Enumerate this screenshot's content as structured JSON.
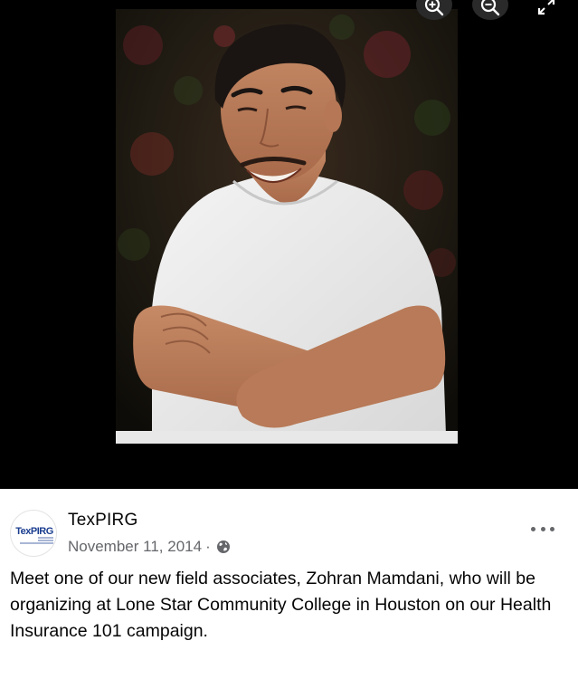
{
  "viewer": {
    "zoom_in_icon": "zoom-in-icon",
    "zoom_out_icon": "zoom-out-icon",
    "fullscreen_icon": "expand-icon",
    "photo_alt": "Photo of a smiling young man in a white t-shirt"
  },
  "post": {
    "page_name": "TexPIRG",
    "date": "November 11, 2014",
    "separator": "·",
    "audience_icon": "globe-icon",
    "avatar_logo_text": "TexPIRG",
    "more_icon": "more-options-icon",
    "text": "Meet one of our new field associates, Zohran Mamdani, who will be organizing at Lone Star Community College in Houston on our Health Insurance 101 campaign."
  },
  "colors": {
    "viewer_background": "#000000",
    "post_background": "#ffffff",
    "text_primary": "#050505",
    "text_secondary": "#65676b",
    "logo_blue": "#1a3d8f"
  }
}
